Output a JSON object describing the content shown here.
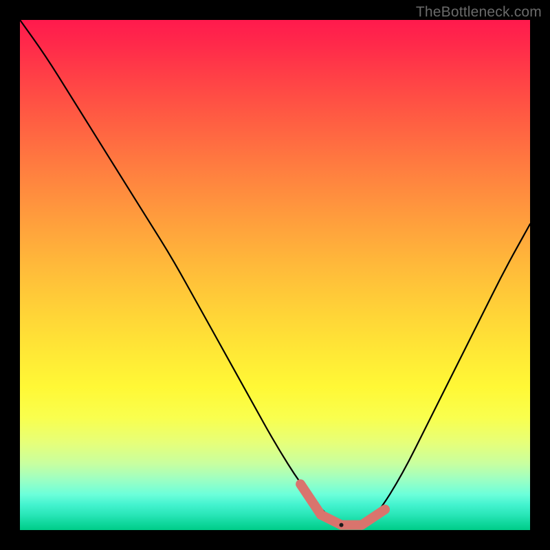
{
  "watermark": "TheBottleneck.com",
  "colors": {
    "background": "#000000",
    "curve_stroke": "#000000",
    "marker_fill": "#d9746d",
    "watermark_text": "#6a6a6a"
  },
  "chart_data": {
    "type": "line",
    "title": "",
    "xlabel": "",
    "ylabel": "",
    "xlim": [
      0,
      100
    ],
    "ylim": [
      0,
      100
    ],
    "grid": false,
    "legend": false,
    "background_gradient": {
      "direction": "vertical",
      "stops": [
        {
          "pos": 0,
          "color": "#ff1a4d"
        },
        {
          "pos": 0.3,
          "color": "#ff7a40"
        },
        {
          "pos": 0.6,
          "color": "#ffd537"
        },
        {
          "pos": 0.78,
          "color": "#f9ff4e"
        },
        {
          "pos": 0.9,
          "color": "#9effc2"
        },
        {
          "pos": 1.0,
          "color": "#00cc88"
        }
      ]
    },
    "series": [
      {
        "name": "bottleneck-curve",
        "x": [
          0,
          5,
          10,
          15,
          20,
          25,
          30,
          35,
          40,
          45,
          50,
          55,
          60,
          63,
          67,
          70,
          75,
          80,
          85,
          90,
          95,
          100
        ],
        "values": [
          100,
          93,
          85,
          77,
          69,
          61,
          53,
          44,
          35,
          26,
          17,
          9,
          3,
          1,
          1,
          3,
          11,
          21,
          31,
          41,
          51,
          60
        ]
      }
    ],
    "markers": [
      {
        "name": "marker-left-end",
        "x": 55,
        "y": 9
      },
      {
        "name": "marker-min-left",
        "x": 59,
        "y": 3
      },
      {
        "name": "marker-min-mid",
        "x": 63,
        "y": 1
      },
      {
        "name": "marker-min-right",
        "x": 67,
        "y": 1
      },
      {
        "name": "marker-right-end",
        "x": 70,
        "y": 3
      }
    ]
  }
}
